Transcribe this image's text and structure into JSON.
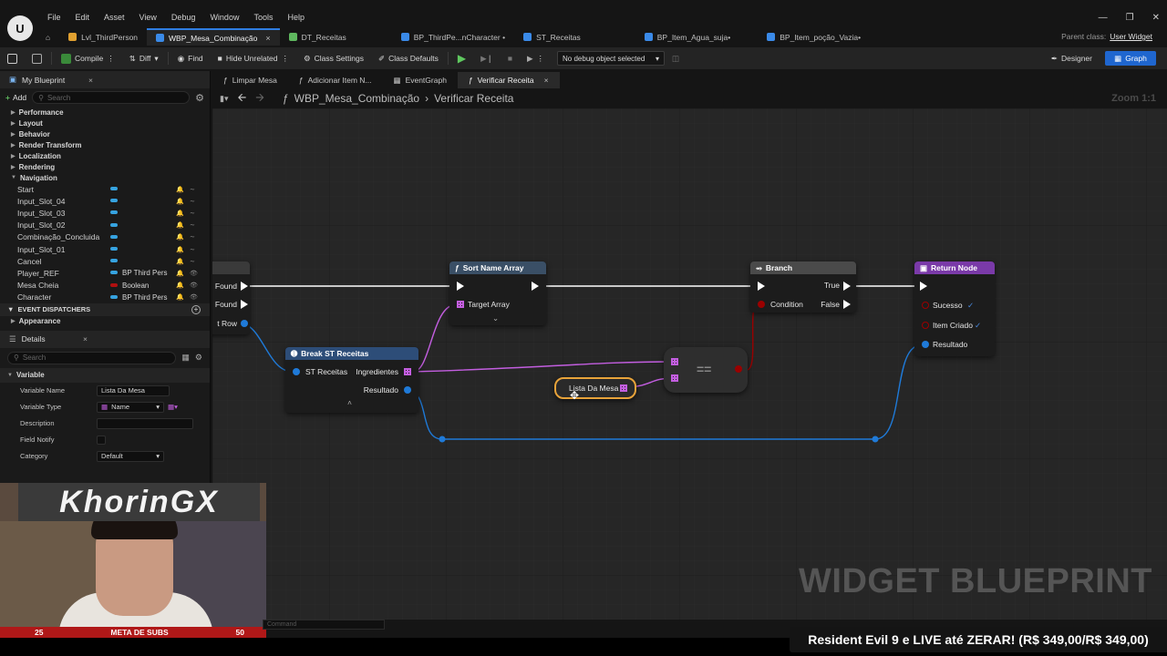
{
  "menu": [
    "File",
    "Edit",
    "Asset",
    "View",
    "Debug",
    "Window",
    "Tools",
    "Help"
  ],
  "doc_tabs": [
    {
      "label": "Lvl_ThirdPerson",
      "color": "#e0a030",
      "active": false
    },
    {
      "label": "WBP_Mesa_Combinação",
      "color": "#3a8ae8",
      "active": true,
      "close": "×"
    },
    {
      "label": "DT_Receitas",
      "color": "#5fb85f",
      "active": false
    },
    {
      "label": "BP_ThirdPe...nCharacter •",
      "color": "#3a8ae8",
      "active": false
    },
    {
      "label": "ST_Receitas",
      "color": "#3a8ae8",
      "active": false
    },
    {
      "label": "BP_Item_Agua_suja•",
      "color": "#3a8ae8",
      "active": false
    },
    {
      "label": "BP_Item_poção_Vazia•",
      "color": "#3a8ae8",
      "active": false
    }
  ],
  "parent_class": {
    "label": "Parent class:",
    "value": "User Widget"
  },
  "toolbar": {
    "compile": "Compile",
    "diff": "Diff",
    "find": "Find",
    "hide_unrelated": "Hide Unrelated",
    "class_settings": "Class Settings",
    "class_defaults": "Class Defaults",
    "debug_select": "No debug object selected",
    "designer": "Designer",
    "graph": "Graph"
  },
  "left_panel": {
    "tab": "My Blueprint",
    "close": "×",
    "add": "Add",
    "search_placeholder": "Search",
    "categories": [
      "Performance",
      "Layout",
      "Behavior",
      "Render Transform",
      "Localization",
      "Rendering",
      "Navigation"
    ],
    "variables": [
      {
        "name": "Start",
        "color": "#36a3e0",
        "type": ""
      },
      {
        "name": "Input_Slot_04",
        "color": "#36a3e0",
        "type": ""
      },
      {
        "name": "Input_Slot_03",
        "color": "#36a3e0",
        "type": ""
      },
      {
        "name": "Input_Slot_02",
        "color": "#36a3e0",
        "type": ""
      },
      {
        "name": "Combinação_Concluida",
        "color": "#36a3e0",
        "type": ""
      },
      {
        "name": "Input_Slot_01",
        "color": "#36a3e0",
        "type": ""
      },
      {
        "name": "Cancel",
        "color": "#36a3e0",
        "type": ""
      },
      {
        "name": "Player_REF",
        "color": "#36a3e0",
        "type": "BP Third Pers"
      },
      {
        "name": "Mesa Cheia",
        "color": "#b01010",
        "type": "Boolean"
      },
      {
        "name": "Character",
        "color": "#36a3e0",
        "type": "BP Third Pers"
      }
    ],
    "event_dispatchers": "EVENT DISPATCHERS",
    "appearance": "Appearance",
    "details_tab": "Details",
    "details_search_placeholder": "Search",
    "variable_section": "Variable",
    "details": {
      "variable_name_label": "Variable Name",
      "variable_name_value": "Lista Da Mesa",
      "variable_type_label": "Variable Type",
      "variable_type_value": "Name",
      "description_label": "Description",
      "field_notify_label": "Field Notify",
      "category_label": "Category",
      "category_value": "Default"
    }
  },
  "graph": {
    "tabs": [
      {
        "label": "Limpar Mesa",
        "active": false
      },
      {
        "label": "Adicionar Item N...",
        "active": false
      },
      {
        "label": "EventGraph",
        "active": false
      },
      {
        "label": "Verificar Receita",
        "active": true,
        "close": "×"
      }
    ],
    "breadcrumb_root": "WBP_Mesa_Combinação",
    "breadcrumb_sep": "›",
    "breadcrumb_leaf": "Verificar Receita",
    "zoom": "Zoom 1:1",
    "watermark": "WIDGET BLUEPRINT",
    "nodes": {
      "partial": {
        "found_1": "Found",
        "found_2": "Found",
        "row": "t Row"
      },
      "sort": {
        "title": "Sort Name Array",
        "pin_target": "Target Array"
      },
      "break": {
        "title": "Break ST Receitas",
        "pin_in": "ST Receitas",
        "pin_ingredientes": "Ingredientes",
        "pin_resultado": "Resultado"
      },
      "lista": {
        "title": "Lista Da Mesa"
      },
      "equal": {
        "symbol": "=="
      },
      "branch": {
        "title": "Branch",
        "pin_condition": "Condition",
        "pin_true": "True",
        "pin_false": "False"
      },
      "return": {
        "title": "Return Node",
        "pin_sucesso": "Sucesso",
        "pin_item": "Item Criado",
        "pin_resultado": "Resultado"
      }
    },
    "colors": {
      "exec": "#ffffff",
      "name_array": "#c35ee0",
      "struct": "#1f7ad8",
      "bool": "#9a0000",
      "sort_header": "#3a4f66",
      "branch_header": "#4a4a4a",
      "return_header": "#7a3aa8",
      "break_header": "#2d4d78"
    }
  },
  "stream": {
    "banner": "KhorinGX",
    "subs_left": "25",
    "subs_label": "META DE SUBS",
    "subs_right": "50",
    "command_placeholder": "Command",
    "promo": "Resident Evil 9 e LIVE até ZERAR! (R$ 349,00/R$ 349,00)"
  }
}
